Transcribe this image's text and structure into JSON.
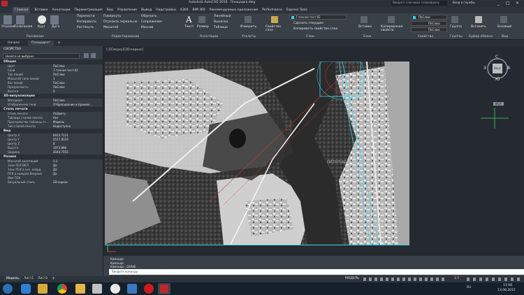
{
  "title_bar": {
    "window_title": "Autodesk AutoCAD 2016 · Площадка.dwg",
    "search_placeholder": "Введите ключевое слово/фразу",
    "signin": "Вход в службы"
  },
  "ribbon_tabs": [
    "Главная",
    "Вставка",
    "Аннотации",
    "Параметризация",
    "Вид",
    "Управление",
    "Вывод",
    "Надстройки",
    "A360",
    "BIM 360",
    "Рекомендуемые приложения",
    "Performance",
    "Express Tools"
  ],
  "ribbon": {
    "draw": {
      "label": "Рисование",
      "tools": [
        "Отрезок",
        "Полилиния",
        "Круг",
        "Дуга"
      ]
    },
    "modify": {
      "label": "Редактирование",
      "tools": [
        "Перенести",
        "Повернуть",
        "Обрезать",
        "Копировать",
        "Отразить зеркально",
        "Сопряжение",
        "Растянуть",
        "Масштаб",
        "Массив"
      ]
    },
    "annotation": {
      "label": "Аннотации",
      "tools": [
        "Текст",
        "Размер",
        "Линейный",
        "Выноска",
        "Таблица"
      ]
    },
    "utilities": {
      "label": "Утилиты",
      "tools": [
        "Измерить"
      ]
    },
    "layers": {
      "label": "Слои",
      "tools": [
        "Свойства слоя",
        "Сделать текущим",
        "Копировать свойства слоя"
      ],
      "current_layer": "7-точная тест-02"
    },
    "block": {
      "label": "Блок",
      "tools": [
        "Вставка"
      ]
    },
    "properties": {
      "label": "Свойства",
      "tools": [
        "Копирование свойств"
      ],
      "color": "ПоСлою",
      "linetype": "ПоСлою",
      "lineweight": "ПоСлою"
    },
    "groups": {
      "label": "Группы",
      "tools": [
        "Группа"
      ]
    },
    "clipboard": {
      "label": "Буфер обмена",
      "tools": [
        "Вставить"
      ]
    },
    "view": {
      "label": "Вид",
      "tools": [
        "Базовый"
      ]
    }
  },
  "file_tabs": [
    "Начало",
    "Площадка*"
  ],
  "properties_panel": {
    "title": "СВОЙСТВА",
    "selector": "Ничего не выбрано",
    "sections": [
      {
        "name": "Общие",
        "rows": [
          [
            "Цвет",
            "ПоСлою"
          ],
          [
            "Слой",
            "7-точная тест-02"
          ],
          [
            "Тип линий",
            "ПоСлою"
          ],
          [
            "Масштаб типа линий",
            "1"
          ],
          [
            "Вес линий",
            "ПоСлою"
          ],
          [
            "Прозрачность",
            "ПоСлою"
          ],
          [
            "Высота",
            "0"
          ]
        ]
      },
      {
        "name": "3D-визуализация",
        "rows": [
          [
            "Материал",
            "ПоСлою"
          ],
          [
            "Отображение тени",
            "Отбрасывание и приним..."
          ]
        ]
      },
      {
        "name": "Стиль печати",
        "rows": [
          [
            "Стиль печати",
            "ПоЦвету"
          ],
          [
            "Таблица стилей печати",
            "Нет"
          ],
          [
            "Пространство таблицы ст...",
            "Модель"
          ],
          [
            "Тип стилей печати",
            "Недоступно"
          ]
        ]
      },
      {
        "name": "Вид",
        "rows": [
          [
            "Центр X",
            "6015.7121"
          ],
          [
            "Центр Y",
            "2517.8119"
          ],
          [
            "Центр Z",
            "0"
          ],
          [
            "Высота",
            "1973.896"
          ],
          [
            "Ширина",
            "4044.7593"
          ]
        ]
      },
      {
        "name": "Разное",
        "rows": [
          [
            "Масштаб аннотаций",
            "1:1"
          ],
          [
            "Знак ПСК ВКЛ",
            "Да"
          ],
          [
            "Знак ПСК в нач. коорд.",
            "Да"
          ],
          [
            "ПСК в каждом Вэкране",
            "Да"
          ],
          [
            "Имя ПСК",
            ""
          ],
          [
            "Визуальный стиль",
            "2D-каркас"
          ]
        ]
      }
    ]
  },
  "viewport": {
    "label": "[-][Сверху][2D-каркас]",
    "watermark": "retromap",
    "viewcube": {
      "n": "С",
      "e": "В",
      "s": "Ю",
      "w": "З",
      "face": "Верх"
    },
    "wcs": "МСК"
  },
  "command": {
    "history": [
      "Команда:",
      "Команда:",
      "Команда: _QSAVE"
    ],
    "placeholder": "Введите команду"
  },
  "layout_tabs": [
    "Модель",
    "Лист1",
    "Лист2"
  ],
  "status": {
    "mode": "МОДЕЛЬ",
    "scale": "1:1"
  },
  "taskbar": {
    "lang": "RU",
    "time": "11:08",
    "date": "13.08.2015"
  },
  "colors": {
    "accent_cyan": "#3fd4e8",
    "red": "#d23a3a",
    "ribbon_bg": "#3a4048"
  }
}
